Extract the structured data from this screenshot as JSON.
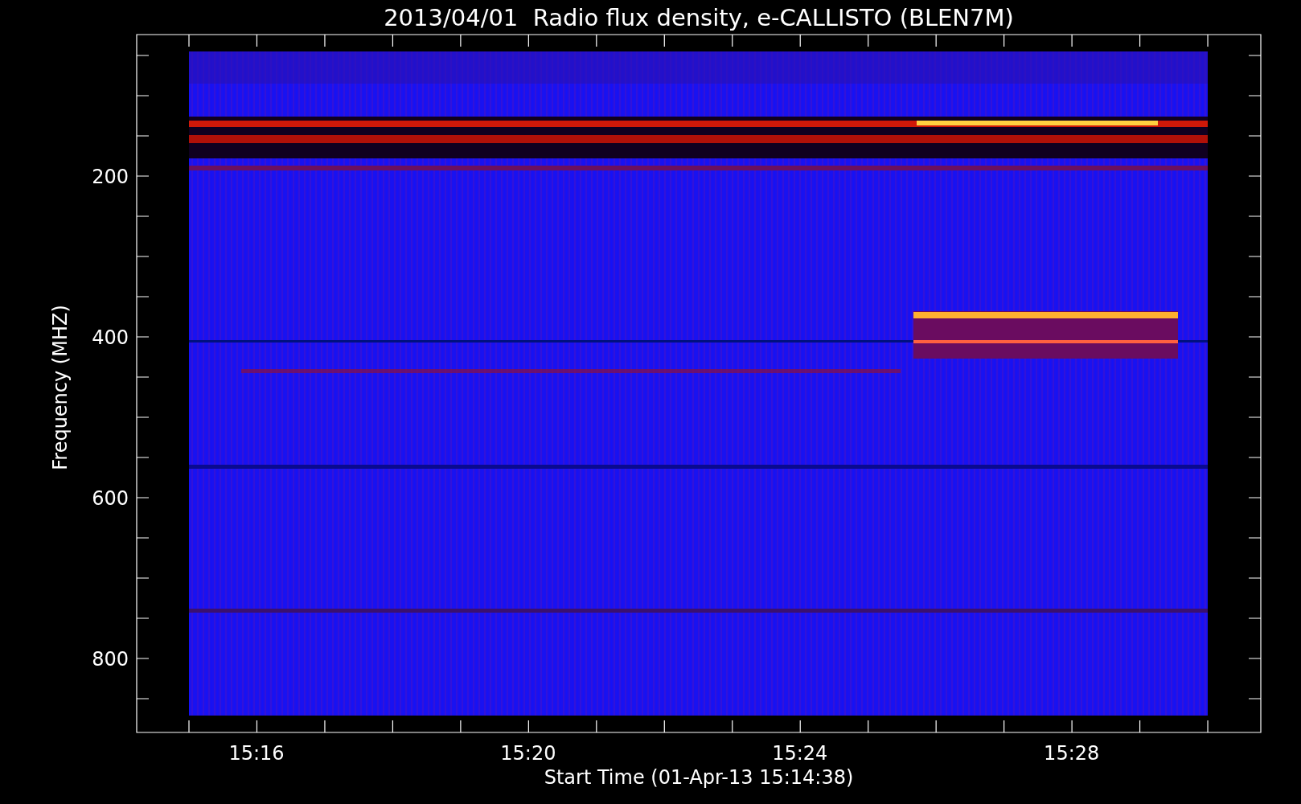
{
  "title": "2013/04/01  Radio flux density, e-CALLISTO (BLEN7M)",
  "y_axis": {
    "label": "Frequency (MHZ)",
    "ticks": [
      "200",
      "400",
      "600",
      "800"
    ]
  },
  "x_axis": {
    "label": "Start Time (01-Apr-13 15:14:38)",
    "ticks": [
      "15:16",
      "15:20",
      "15:24",
      "15:28"
    ]
  }
}
